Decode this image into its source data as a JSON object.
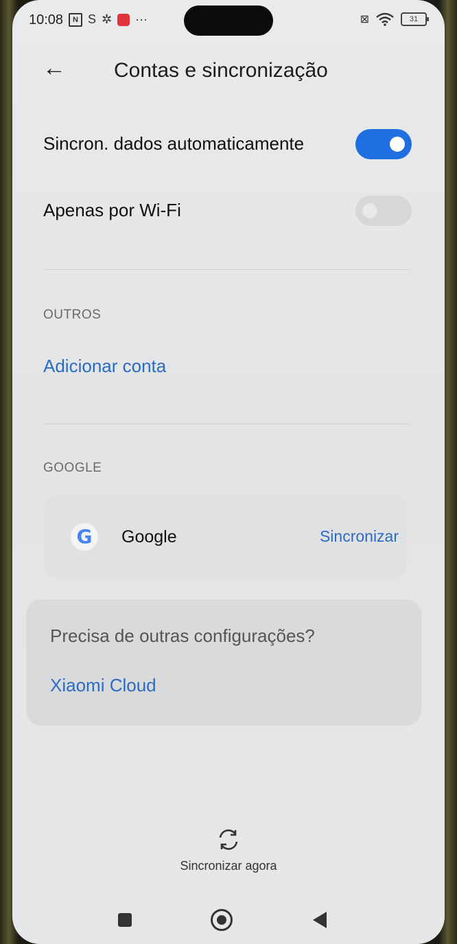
{
  "status_bar": {
    "time": "10:08",
    "battery": "31"
  },
  "header": {
    "back_icon": "arrow-left-icon",
    "title": "Contas e sincronização"
  },
  "settings": {
    "auto_sync_label": "Sincron. dados automaticamente",
    "auto_sync_on": true,
    "wifi_only_label": "Apenas por Wi-Fi",
    "wifi_only_on": false
  },
  "others": {
    "section_label": "OUTROS",
    "add_account_label": "Adicionar conta"
  },
  "google": {
    "section_label": "GOOGLE",
    "account_name": "Google",
    "sync_label": "Sincronizar"
  },
  "more_settings": {
    "question": "Precisa de outras configurações?",
    "link_label": "Xiaomi Cloud"
  },
  "sync_now_label": "Sincronizar agora",
  "colors": {
    "accent": "#1f6fe0",
    "link": "#2c6bc3",
    "background": "#e6e7e9"
  }
}
